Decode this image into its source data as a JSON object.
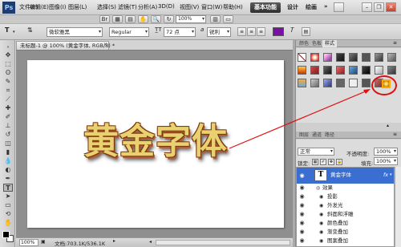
{
  "app": {
    "logo": "Ps"
  },
  "menu": {
    "items": [
      "文件(F)",
      "编辑(E)",
      "图像(I)",
      "图层(L)",
      "选择(S)",
      "滤镜(T)",
      "分析(A)",
      "3D(D)",
      "视图(V)",
      "窗口(W)",
      "帮助(H)"
    ]
  },
  "menubar": {
    "zoom": "100%",
    "workspace_active": "基本功能",
    "workspace_design": "设计",
    "workspace_paint": "绘画",
    "window_min": "–",
    "window_restore": "❐",
    "window_close": "✕"
  },
  "options": {
    "font_family": "微软雅黑",
    "font_style": "Regular",
    "font_size": "72 点",
    "antialias_prefix": "a",
    "antialias": "锐利",
    "text_color": "#7b10a5"
  },
  "document": {
    "tab_title": "未标题-1 @ 100% (黄金字体, RGB/8) *",
    "tab_close": "×",
    "text": "黄金字体",
    "status_zoom": "100%",
    "status_info": "文档:703.1K/536.1K"
  },
  "styles_panel": {
    "tabs": [
      "颜色",
      "色板",
      "样式"
    ],
    "active_tab": "样式"
  },
  "layers_panel": {
    "tabs": [
      "图层",
      "通道",
      "路径"
    ],
    "blend_mode": "正常",
    "opacity_label": "不透明度:",
    "opacity": "100%",
    "lock_label": "锁定:",
    "fill_label": "填充:",
    "fill": "100%",
    "layer_name": "黄金字体",
    "layer_fx": "fx",
    "effects_label": "效果",
    "effects": [
      "投影",
      "外发光",
      "斜面和浮雕",
      "颜色叠加",
      "渐变叠加",
      "图案叠加"
    ]
  }
}
